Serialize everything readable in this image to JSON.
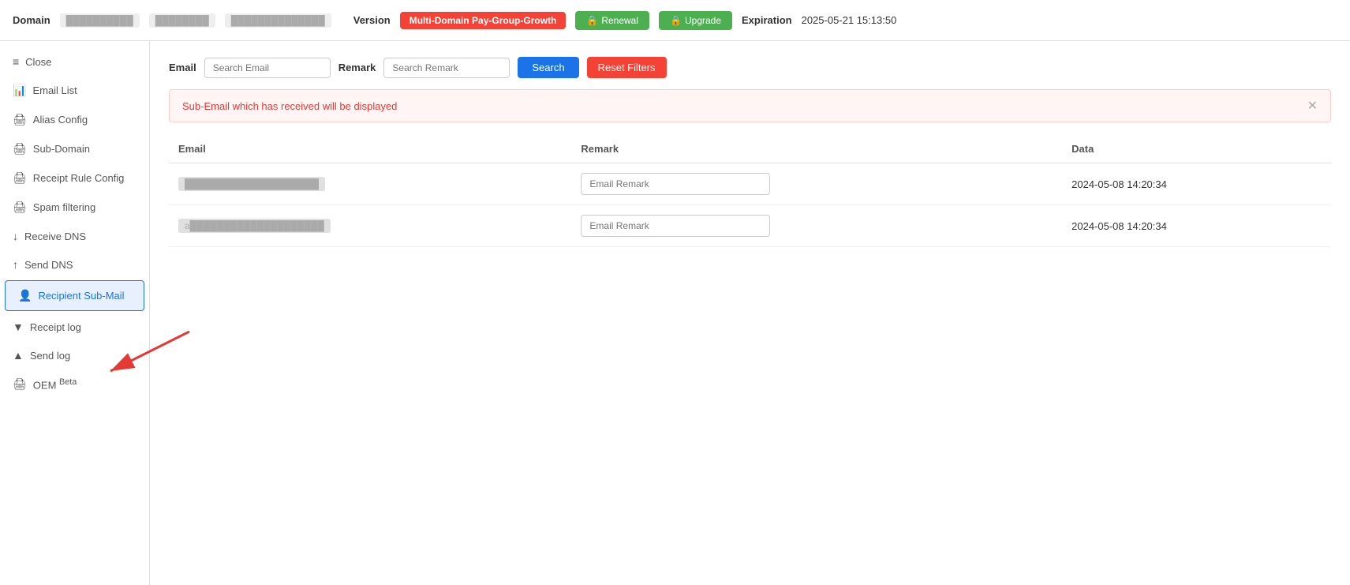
{
  "header": {
    "domain_label": "Domain",
    "domain_value1": "██████████",
    "domain_value2": "████████",
    "domain_value3": "██████████████",
    "version_label": "Version",
    "version_badge": "Multi-Domain Pay-Group-Growth",
    "renewal_btn": "Renewal",
    "upgrade_btn": "Upgrade",
    "expiration_label": "Expiration",
    "expiration_value": "2025-05-21 15:13:50"
  },
  "sidebar": {
    "items": [
      {
        "label": "Close",
        "icon": "≡",
        "active": false
      },
      {
        "label": "Email List",
        "icon": "📊",
        "active": false
      },
      {
        "label": "Alias Config",
        "icon": "🖨",
        "active": false
      },
      {
        "label": "Sub-Domain",
        "icon": "🖨",
        "active": false
      },
      {
        "label": "Receipt Rule Config",
        "icon": "🖨",
        "active": false
      },
      {
        "label": "Spam filtering",
        "icon": "🖨",
        "active": false
      },
      {
        "label": "Receive DNS",
        "icon": "↓",
        "active": false
      },
      {
        "label": "Send DNS",
        "icon": "↑",
        "active": false
      },
      {
        "label": "Recipient Sub-Mail",
        "icon": "👤",
        "active": true
      },
      {
        "label": "Receipt log",
        "icon": "▼",
        "active": false
      },
      {
        "label": "Send log",
        "icon": "▲",
        "active": false
      },
      {
        "label": "OEM Beta",
        "icon": "🖨",
        "active": false
      }
    ]
  },
  "filters": {
    "email_label": "Email",
    "email_placeholder": "Search Email",
    "remark_label": "Remark",
    "remark_placeholder": "Search Remark",
    "search_btn": "Search",
    "reset_btn": "Reset Filters"
  },
  "alert": {
    "message": "Sub-Email which has received will be displayed"
  },
  "table": {
    "headers": [
      "Email",
      "Remark",
      "Data"
    ],
    "rows": [
      {
        "email": "████████████████████",
        "remark_placeholder": "Email Remark",
        "date": "2024-05-08 14:20:34"
      },
      {
        "email": "a████████████████████",
        "remark_placeholder": "Email Remark",
        "date": "2024-05-08 14:20:34"
      }
    ]
  }
}
